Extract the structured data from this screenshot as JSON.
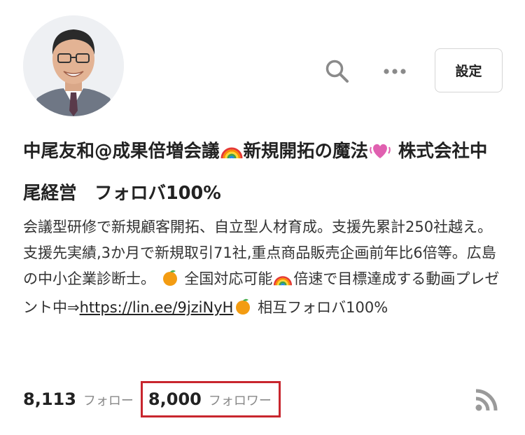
{
  "profile": {
    "avatar_icon": "avatar-photo",
    "name_parts": {
      "part1": "中尾友和@成果倍増会議",
      "part2": "新規開拓の魔法",
      "part3": "株式会社中尾経営　フォロバ100%"
    },
    "name_emojis": [
      "rainbow-icon",
      "beating-heart-icon"
    ]
  },
  "header": {
    "search_icon": "search-icon",
    "more_icon": "more-horizontal-icon",
    "settings_label": "設定"
  },
  "bio": {
    "part1": "会議型研修で新規顧客開拓、自立型人材育成。支援先累計250社越え。支援先実績,3か月で新規取引71社,重点商品販売企画前年比6倍等。広島の中小企業診断士。",
    "part2": "全国対応可能",
    "part3": "倍速で目標達成する動画プレゼント中⇒",
    "link": "https://lin.ee/9jziNyH",
    "part4": "相互フォロバ100%",
    "emojis": [
      "tangerine-icon",
      "rainbow-icon",
      "tangerine-icon"
    ]
  },
  "stats": {
    "following_count": "8,113",
    "following_label": "フォロー",
    "followers_count": "8,000",
    "followers_label": "フォロワー",
    "highlight_color": "#c8262e"
  },
  "rss_icon": "rss-icon"
}
